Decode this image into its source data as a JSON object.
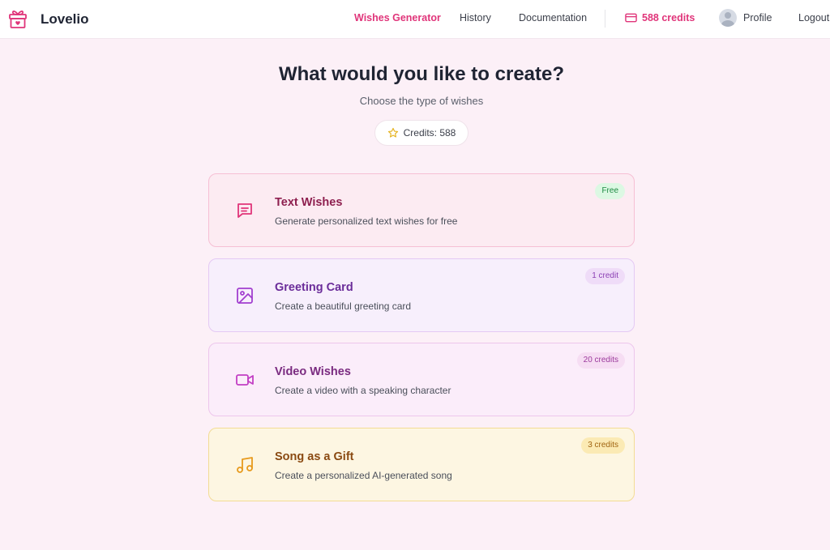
{
  "brand": {
    "name": "Lovelio",
    "logo_icon": "gift-heart-icon"
  },
  "nav": {
    "links": [
      {
        "label": "Wishes Generator",
        "active": true
      },
      {
        "label": "History",
        "active": false
      },
      {
        "label": "Documentation",
        "active": false
      }
    ],
    "credits_label": "588 credits",
    "credits_icon": "credit-card-icon",
    "profile_label": "Profile",
    "logout_label": "Logout"
  },
  "main": {
    "title": "What would you like to create?",
    "subtitle": "Choose the type of wishes",
    "credits_pill": "Credits: 588",
    "credits_pill_icon": "star-icon"
  },
  "cards": [
    {
      "title": "Text Wishes",
      "description": "Generate personalized text wishes for free",
      "badge": "Free",
      "icon": "message-icon"
    },
    {
      "title": "Greeting Card",
      "description": "Create a beautiful greeting card",
      "badge": "1 credit",
      "icon": "image-icon"
    },
    {
      "title": "Video Wishes",
      "description": "Create a video with a speaking character",
      "badge": "20 credits",
      "icon": "video-icon"
    },
    {
      "title": "Song as a Gift",
      "description": "Create a personalized AI-generated song",
      "badge": "3 credits",
      "icon": "music-note-icon"
    }
  ],
  "colors": {
    "accent": "#e0357a",
    "page_background": "#fcf0f7",
    "text_card_border": "#f6bfd4",
    "greeting_card_border": "#e4c9f4",
    "video_card_border": "#edc6ec",
    "song_card_border": "#f3dc94",
    "free_badge": "#1d8a42"
  }
}
